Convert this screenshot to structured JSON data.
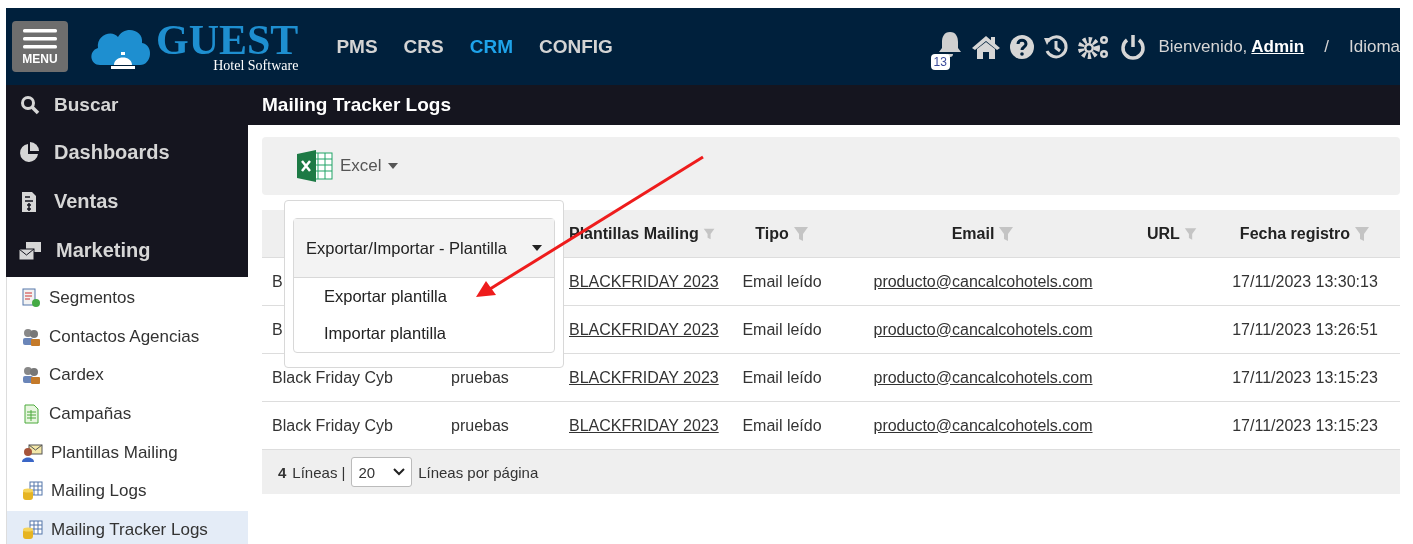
{
  "header": {
    "menu_label": "MENU",
    "logo_title": "GUEST",
    "logo_subtitle": "Hotel Software",
    "nav": [
      {
        "label": "PMS",
        "selected": false
      },
      {
        "label": "CRS",
        "selected": false
      },
      {
        "label": "CRM",
        "selected": true
      },
      {
        "label": "CONFIG",
        "selected": false
      }
    ],
    "notification_count": "13",
    "welcome": "Bienvenido,",
    "user": "Admin",
    "separator": "/",
    "language": "Idioma"
  },
  "search_label": "Buscar",
  "page_title": "Mailing Tracker Logs",
  "sidebar": {
    "sections": [
      {
        "label": "Dashboards",
        "kind": "pie"
      },
      {
        "label": "Ventas",
        "kind": "invoice"
      },
      {
        "label": "Marketing",
        "kind": "mail"
      }
    ],
    "items": [
      {
        "label": "Segmentos",
        "kind": "report",
        "selected": false
      },
      {
        "label": "Contactos Agencias",
        "kind": "people",
        "selected": false
      },
      {
        "label": "Cardex",
        "kind": "people",
        "selected": false
      },
      {
        "label": "Campañas",
        "kind": "sheet",
        "selected": false
      },
      {
        "label": "Plantillas Mailing",
        "kind": "mailperson",
        "selected": false
      },
      {
        "label": "Mailing Logs",
        "kind": "db",
        "selected": false
      },
      {
        "label": "Mailing Tracker Logs",
        "kind": "db",
        "selected": true
      }
    ]
  },
  "toolbar": {
    "excel_label": "Excel"
  },
  "dropdown": {
    "title": "Exportar/Importar - Plantilla",
    "items": [
      "Exportar plantilla",
      "Importar plantilla"
    ]
  },
  "table": {
    "columns": [
      {
        "label": "Plantillas Mailing"
      },
      {
        "label": "Tipo"
      },
      {
        "label": "Email"
      },
      {
        "label": "URL"
      },
      {
        "label": "Fecha registro"
      }
    ],
    "rows": [
      {
        "column_1": "B",
        "plantilla": "BLACKFRIDAY 2023",
        "tipo": "Email leído",
        "email": "producto@cancalcohotels.com",
        "fecha": "17/11/2023 13:30:13"
      },
      {
        "column_1": "B",
        "plantilla": "BLACKFRIDAY 2023",
        "tipo": "Email leído",
        "email": "producto@cancalcohotels.com",
        "fecha": "17/11/2023 13:26:51"
      },
      {
        "column_1": "Black Friday Cyb",
        "column_2": "pruebas",
        "plantilla": "BLACKFRIDAY 2023",
        "tipo": "Email leído",
        "email": "producto@cancalcohotels.com",
        "fecha": "17/11/2023 13:15:23"
      },
      {
        "column_1": "Black Friday Cyb",
        "column_2": "pruebas",
        "plantilla": "BLACKFRIDAY 2023",
        "tipo": "Email leído",
        "email": "producto@cancalcohotels.com",
        "fecha": "17/11/2023 13:15:23"
      }
    ]
  },
  "footer": {
    "count": "4",
    "count_label": "Líneas |",
    "page_size": "20",
    "page_size_label": "Líneas por página"
  }
}
